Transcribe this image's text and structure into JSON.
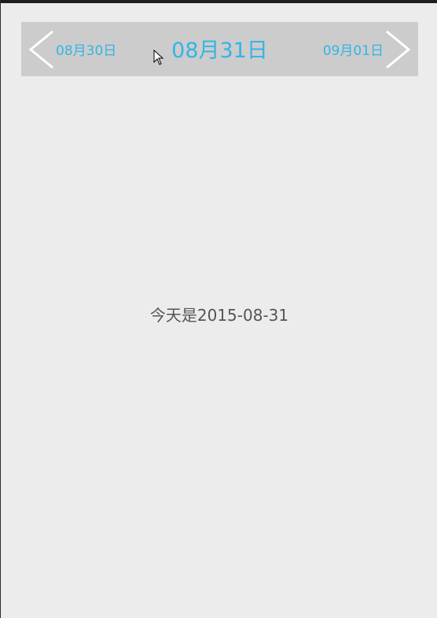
{
  "date_nav": {
    "prev_label": "08月30日",
    "current_label": "08月31日",
    "next_label": "09月01日"
  },
  "content": {
    "today_text": "今天是2015-08-31"
  },
  "colors": {
    "accent": "#33b5e5",
    "nav_background": "#cccccc",
    "page_background": "#ececec",
    "body_text": "#555555"
  },
  "icons": {
    "prev": "chevron-left-icon",
    "next": "chevron-right-icon",
    "pointer": "mouse-cursor-icon"
  }
}
